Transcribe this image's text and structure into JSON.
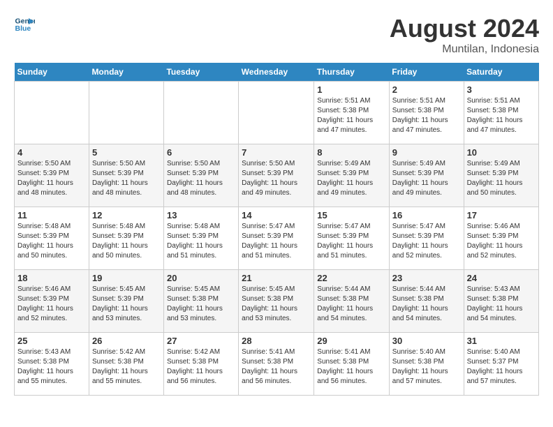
{
  "logo": {
    "line1": "General",
    "line2": "Blue"
  },
  "title": "August 2024",
  "subtitle": "Muntilan, Indonesia",
  "days_of_week": [
    "Sunday",
    "Monday",
    "Tuesday",
    "Wednesday",
    "Thursday",
    "Friday",
    "Saturday"
  ],
  "weeks": [
    [
      {
        "day": "",
        "info": ""
      },
      {
        "day": "",
        "info": ""
      },
      {
        "day": "",
        "info": ""
      },
      {
        "day": "",
        "info": ""
      },
      {
        "day": "1",
        "info": "Sunrise: 5:51 AM\nSunset: 5:38 PM\nDaylight: 11 hours\nand 47 minutes."
      },
      {
        "day": "2",
        "info": "Sunrise: 5:51 AM\nSunset: 5:38 PM\nDaylight: 11 hours\nand 47 minutes."
      },
      {
        "day": "3",
        "info": "Sunrise: 5:51 AM\nSunset: 5:38 PM\nDaylight: 11 hours\nand 47 minutes."
      }
    ],
    [
      {
        "day": "4",
        "info": "Sunrise: 5:50 AM\nSunset: 5:39 PM\nDaylight: 11 hours\nand 48 minutes."
      },
      {
        "day": "5",
        "info": "Sunrise: 5:50 AM\nSunset: 5:39 PM\nDaylight: 11 hours\nand 48 minutes."
      },
      {
        "day": "6",
        "info": "Sunrise: 5:50 AM\nSunset: 5:39 PM\nDaylight: 11 hours\nand 48 minutes."
      },
      {
        "day": "7",
        "info": "Sunrise: 5:50 AM\nSunset: 5:39 PM\nDaylight: 11 hours\nand 49 minutes."
      },
      {
        "day": "8",
        "info": "Sunrise: 5:49 AM\nSunset: 5:39 PM\nDaylight: 11 hours\nand 49 minutes."
      },
      {
        "day": "9",
        "info": "Sunrise: 5:49 AM\nSunset: 5:39 PM\nDaylight: 11 hours\nand 49 minutes."
      },
      {
        "day": "10",
        "info": "Sunrise: 5:49 AM\nSunset: 5:39 PM\nDaylight: 11 hours\nand 50 minutes."
      }
    ],
    [
      {
        "day": "11",
        "info": "Sunrise: 5:48 AM\nSunset: 5:39 PM\nDaylight: 11 hours\nand 50 minutes."
      },
      {
        "day": "12",
        "info": "Sunrise: 5:48 AM\nSunset: 5:39 PM\nDaylight: 11 hours\nand 50 minutes."
      },
      {
        "day": "13",
        "info": "Sunrise: 5:48 AM\nSunset: 5:39 PM\nDaylight: 11 hours\nand 51 minutes."
      },
      {
        "day": "14",
        "info": "Sunrise: 5:47 AM\nSunset: 5:39 PM\nDaylight: 11 hours\nand 51 minutes."
      },
      {
        "day": "15",
        "info": "Sunrise: 5:47 AM\nSunset: 5:39 PM\nDaylight: 11 hours\nand 51 minutes."
      },
      {
        "day": "16",
        "info": "Sunrise: 5:47 AM\nSunset: 5:39 PM\nDaylight: 11 hours\nand 52 minutes."
      },
      {
        "day": "17",
        "info": "Sunrise: 5:46 AM\nSunset: 5:39 PM\nDaylight: 11 hours\nand 52 minutes."
      }
    ],
    [
      {
        "day": "18",
        "info": "Sunrise: 5:46 AM\nSunset: 5:39 PM\nDaylight: 11 hours\nand 52 minutes."
      },
      {
        "day": "19",
        "info": "Sunrise: 5:45 AM\nSunset: 5:39 PM\nDaylight: 11 hours\nand 53 minutes."
      },
      {
        "day": "20",
        "info": "Sunrise: 5:45 AM\nSunset: 5:38 PM\nDaylight: 11 hours\nand 53 minutes."
      },
      {
        "day": "21",
        "info": "Sunrise: 5:45 AM\nSunset: 5:38 PM\nDaylight: 11 hours\nand 53 minutes."
      },
      {
        "day": "22",
        "info": "Sunrise: 5:44 AM\nSunset: 5:38 PM\nDaylight: 11 hours\nand 54 minutes."
      },
      {
        "day": "23",
        "info": "Sunrise: 5:44 AM\nSunset: 5:38 PM\nDaylight: 11 hours\nand 54 minutes."
      },
      {
        "day": "24",
        "info": "Sunrise: 5:43 AM\nSunset: 5:38 PM\nDaylight: 11 hours\nand 54 minutes."
      }
    ],
    [
      {
        "day": "25",
        "info": "Sunrise: 5:43 AM\nSunset: 5:38 PM\nDaylight: 11 hours\nand 55 minutes."
      },
      {
        "day": "26",
        "info": "Sunrise: 5:42 AM\nSunset: 5:38 PM\nDaylight: 11 hours\nand 55 minutes."
      },
      {
        "day": "27",
        "info": "Sunrise: 5:42 AM\nSunset: 5:38 PM\nDaylight: 11 hours\nand 56 minutes."
      },
      {
        "day": "28",
        "info": "Sunrise: 5:41 AM\nSunset: 5:38 PM\nDaylight: 11 hours\nand 56 minutes."
      },
      {
        "day": "29",
        "info": "Sunrise: 5:41 AM\nSunset: 5:38 PM\nDaylight: 11 hours\nand 56 minutes."
      },
      {
        "day": "30",
        "info": "Sunrise: 5:40 AM\nSunset: 5:38 PM\nDaylight: 11 hours\nand 57 minutes."
      },
      {
        "day": "31",
        "info": "Sunrise: 5:40 AM\nSunset: 5:37 PM\nDaylight: 11 hours\nand 57 minutes."
      }
    ]
  ]
}
